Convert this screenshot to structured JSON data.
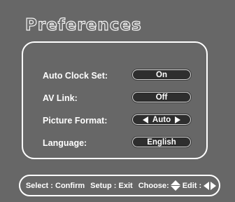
{
  "title": "Preferences",
  "settings": [
    {
      "label": "Auto Clock Set:",
      "value": "On",
      "arrows": false
    },
    {
      "label": "AV Link:",
      "value": "Off",
      "arrows": false
    },
    {
      "label": "Picture Format:",
      "value": "Auto",
      "arrows": true
    },
    {
      "label": "Language:",
      "value": "English",
      "arrows": false
    }
  ],
  "footer": {
    "select": "Select : Confirm",
    "setup": "Setup : Exit",
    "choose": "Choose:",
    "edit": "Edit :"
  },
  "colors": {
    "background": "#676767",
    "pill": "#2e2e2e",
    "text": "#ffffff"
  }
}
